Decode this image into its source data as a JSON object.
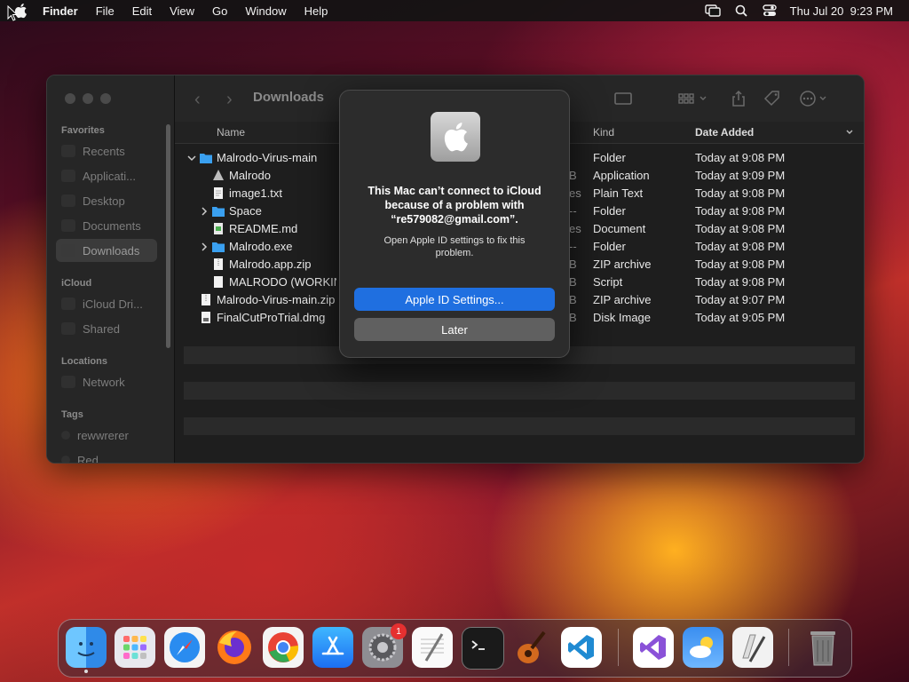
{
  "menubar": {
    "app_name": "Finder",
    "menus": [
      "File",
      "Edit",
      "View",
      "Go",
      "Window",
      "Help"
    ],
    "clock": "Thu Jul 20  9:23 PM"
  },
  "finder": {
    "location_title": "Downloads",
    "sidebar": {
      "favorites_header": "Favorites",
      "favorites": [
        "Recents",
        "Applicati...",
        "Desktop",
        "Documents",
        "Downloads"
      ],
      "selected": "Downloads",
      "icloud_header": "iCloud",
      "icloud": [
        "iCloud Dri...",
        "Shared"
      ],
      "locations_header": "Locations",
      "locations": [
        "Network"
      ],
      "tags_header": "Tags",
      "tags": [
        "rewwrerer",
        "Red"
      ]
    },
    "columns": {
      "name": "Name",
      "kind": "Kind",
      "date_added": "Date Added"
    },
    "files": [
      {
        "name": "Malrodo-Virus-main",
        "size": "",
        "kind": "Folder",
        "date": "Today at 9:08 PM"
      },
      {
        "name": "Malrodo",
        "size": "B",
        "kind": "Application",
        "date": "Today at 9:09 PM"
      },
      {
        "name": "image1.txt",
        "size": "es",
        "kind": "Plain Text",
        "date": "Today at 9:08 PM"
      },
      {
        "name": "Space",
        "size": "--",
        "kind": "Folder",
        "date": "Today at 9:08 PM"
      },
      {
        "name": "README.md",
        "size": "es",
        "kind": "Document",
        "date": "Today at 9:08 PM"
      },
      {
        "name": "Malrodo.exe",
        "size": "--",
        "kind": "Folder",
        "date": "Today at 9:08 PM"
      },
      {
        "name": "Malrodo.app.zip",
        "size": "B",
        "kind": "ZIP archive",
        "date": "Today at 9:08 PM"
      },
      {
        "name": "MALRODO (WORKIN",
        "size": "B",
        "kind": "Script",
        "date": "Today at 9:08 PM"
      },
      {
        "name": "Malrodo-Virus-main.zip",
        "size": "B",
        "kind": "ZIP archive",
        "date": "Today at 9:07 PM"
      },
      {
        "name": "FinalCutProTrial.dmg",
        "size": "B",
        "kind": "Disk Image",
        "date": "Today at 9:05 PM"
      }
    ]
  },
  "dialog": {
    "title": "This Mac can’t connect to iCloud because of a problem with “re579082@gmail.com”.",
    "message": "Open Apple ID settings to fix this problem.",
    "primary_button": "Apple ID Settings...",
    "secondary_button": "Later"
  },
  "dock": {
    "apps": [
      "finder-icon",
      "launchpad-icon",
      "safari-icon",
      "firefox-icon",
      "chrome-icon",
      "app-store-icon",
      "system-settings-icon",
      "textedit-icon",
      "terminal-icon",
      "garageband-icon",
      "vscode-icon",
      "visual-studio-icon",
      "weather-icon",
      "script-editor-icon",
      "trash-icon"
    ],
    "system_settings_badge": "1"
  },
  "colors": {
    "accent": "#1f6fe0",
    "folder": "#3aa0f0",
    "window_bg": "#1e1e1e",
    "dialog_bg": "#2c2c2c"
  }
}
